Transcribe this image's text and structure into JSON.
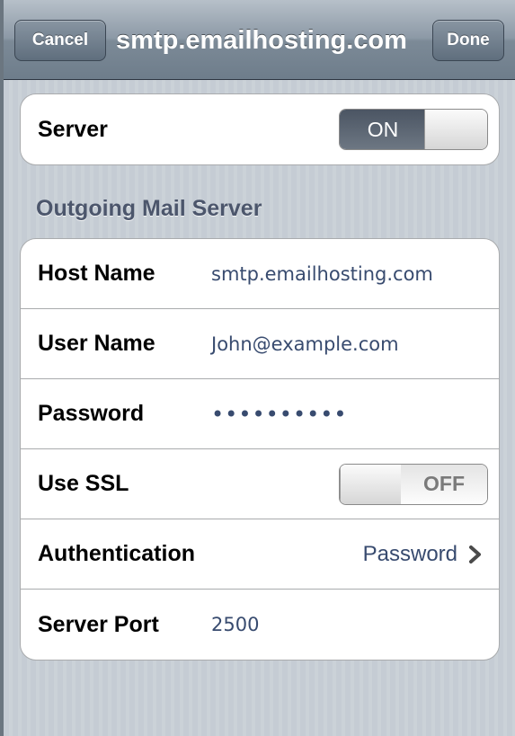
{
  "navbar": {
    "cancel_label": "Cancel",
    "title": "smtp.emailhosting.com",
    "done_label": "Done"
  },
  "server_group": {
    "label": "Server",
    "toggle": {
      "state": "ON",
      "on": true
    }
  },
  "section_header": "Outgoing Mail Server",
  "fields": {
    "host_name": {
      "label": "Host Name",
      "value": "smtp.emailhosting.com"
    },
    "user_name": {
      "label": "User Name",
      "value": "John@example.com"
    },
    "password": {
      "label": "Password",
      "value": "••••••••••"
    },
    "use_ssl": {
      "label": "Use SSL",
      "toggle_state": "OFF",
      "on": false
    },
    "authentication": {
      "label": "Authentication",
      "value": "Password",
      "icon": "chevron-right-icon"
    },
    "server_port": {
      "label": "Server Port",
      "value": "2500"
    }
  },
  "colors": {
    "nav_bar": "#7c8a97",
    "background_stripes": "#c5ccd4",
    "value_text": "#384b6f",
    "toggle_on_track": "#4b5563"
  }
}
